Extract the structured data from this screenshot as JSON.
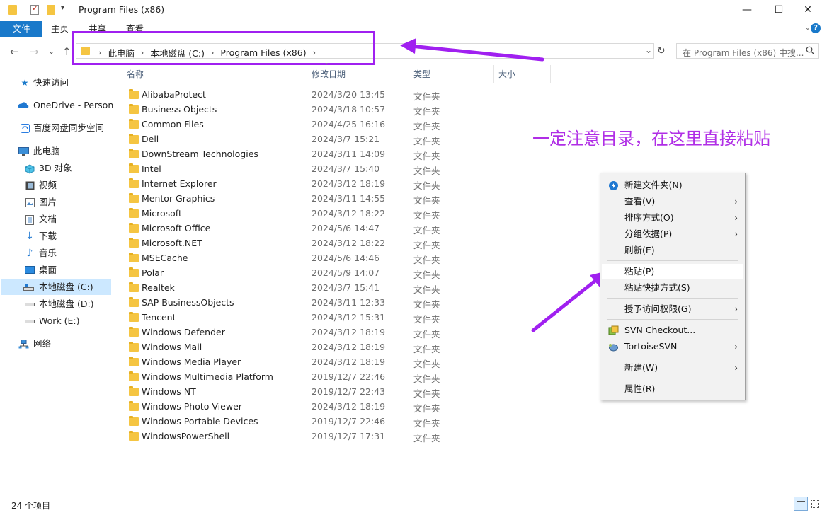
{
  "window": {
    "title": "Program Files (x86)",
    "controls": {
      "minimize": "—",
      "maximize": "☐",
      "close": "✕"
    }
  },
  "ribbon": {
    "tabs": [
      "文件",
      "主页",
      "共享",
      "查看"
    ],
    "file_tab_color": "#1979ca",
    "expand_glyph": "⌄",
    "help_glyph": "?"
  },
  "navigation": {
    "back_glyph": "←",
    "forward_glyph": "→",
    "recent_glyph": "⌄",
    "up_glyph": "↑",
    "breadcrumbs": [
      "此电脑",
      "本地磁盘 (C:)",
      "Program Files (x86)"
    ],
    "crumb_separator": "›",
    "dropdown_glyph": "⌄",
    "refresh_glyph": "↻",
    "search_placeholder": "在 Program Files (x86) 中搜...",
    "search_icon": "search-icon"
  },
  "sidebar": {
    "items": [
      {
        "label": "快速访问",
        "icon": "star-icon"
      },
      {
        "label": "OneDrive - Persona",
        "icon": "cloud-icon"
      },
      {
        "label": "百度网盘同步空间",
        "icon": "baidu-netdisk-icon"
      },
      {
        "label": "此电脑",
        "icon": "computer-icon"
      },
      {
        "label": "3D 对象",
        "icon": "3d-objects-icon"
      },
      {
        "label": "视频",
        "icon": "video-icon"
      },
      {
        "label": "图片",
        "icon": "pictures-icon"
      },
      {
        "label": "文档",
        "icon": "documents-icon"
      },
      {
        "label": "下载",
        "icon": "download-icon"
      },
      {
        "label": "音乐",
        "icon": "music-icon"
      },
      {
        "label": "桌面",
        "icon": "desktop-icon"
      },
      {
        "label": "本地磁盘 (C:)",
        "icon": "drive-c-icon",
        "selected": true
      },
      {
        "label": "本地磁盘 (D:)",
        "icon": "drive-icon"
      },
      {
        "label": "Work (E:)",
        "icon": "drive-icon"
      },
      {
        "label": "网络",
        "icon": "network-icon"
      }
    ]
  },
  "columns": {
    "name": "名称",
    "modified": "修改日期",
    "type": "类型",
    "size": "大小"
  },
  "files": [
    {
      "name": "AlibabaProtect",
      "modified": "2024/3/20 13:45",
      "type": "文件夹"
    },
    {
      "name": "Business Objects",
      "modified": "2024/3/18 10:57",
      "type": "文件夹"
    },
    {
      "name": "Common Files",
      "modified": "2024/4/25 16:16",
      "type": "文件夹"
    },
    {
      "name": "Dell",
      "modified": "2024/3/7 15:21",
      "type": "文件夹"
    },
    {
      "name": "DownStream Technologies",
      "modified": "2024/3/11 14:09",
      "type": "文件夹"
    },
    {
      "name": "Intel",
      "modified": "2024/3/7 15:40",
      "type": "文件夹"
    },
    {
      "name": "Internet Explorer",
      "modified": "2024/3/12 18:19",
      "type": "文件夹"
    },
    {
      "name": "Mentor Graphics",
      "modified": "2024/3/11 14:55",
      "type": "文件夹"
    },
    {
      "name": "Microsoft",
      "modified": "2024/3/12 18:22",
      "type": "文件夹"
    },
    {
      "name": "Microsoft Office",
      "modified": "2024/5/6 14:47",
      "type": "文件夹"
    },
    {
      "name": "Microsoft.NET",
      "modified": "2024/3/12 18:22",
      "type": "文件夹"
    },
    {
      "name": "MSECache",
      "modified": "2024/5/6 14:46",
      "type": "文件夹"
    },
    {
      "name": "Polar",
      "modified": "2024/5/9 14:07",
      "type": "文件夹"
    },
    {
      "name": "Realtek",
      "modified": "2024/3/7 15:41",
      "type": "文件夹"
    },
    {
      "name": "SAP BusinessObjects",
      "modified": "2024/3/11 12:33",
      "type": "文件夹"
    },
    {
      "name": "Tencent",
      "modified": "2024/3/12 15:31",
      "type": "文件夹"
    },
    {
      "name": "Windows Defender",
      "modified": "2024/3/12 18:19",
      "type": "文件夹"
    },
    {
      "name": "Windows Mail",
      "modified": "2024/3/12 18:19",
      "type": "文件夹"
    },
    {
      "name": "Windows Media Player",
      "modified": "2024/3/12 18:19",
      "type": "文件夹"
    },
    {
      "name": "Windows Multimedia Platform",
      "modified": "2019/12/7 22:46",
      "type": "文件夹"
    },
    {
      "name": "Windows NT",
      "modified": "2019/12/7 22:43",
      "type": "文件夹"
    },
    {
      "name": "Windows Photo Viewer",
      "modified": "2024/3/12 18:19",
      "type": "文件夹"
    },
    {
      "name": "Windows Portable Devices",
      "modified": "2019/12/7 22:46",
      "type": "文件夹"
    },
    {
      "name": "WindowsPowerShell",
      "modified": "2019/12/7 17:31",
      "type": "文件夹"
    }
  ],
  "annotation": {
    "text": "一定注意目录，在这里直接粘贴",
    "color": "#b02ee6"
  },
  "context_menu": {
    "items": [
      {
        "label": "新建文件夹(N)",
        "icon": "new-folder-icon"
      },
      {
        "label": "查看(V)",
        "submenu": true
      },
      {
        "label": "排序方式(O)",
        "submenu": true
      },
      {
        "label": "分组依据(P)",
        "submenu": true
      },
      {
        "label": "刷新(E)"
      },
      {
        "label": "粘贴(P)",
        "highlighted": true
      },
      {
        "label": "粘贴快捷方式(S)"
      },
      {
        "label": "授予访问权限(G)",
        "submenu": true
      },
      {
        "label": "SVN Checkout...",
        "icon": "svn-checkout-icon"
      },
      {
        "label": "TortoiseSVN",
        "icon": "tortoise-svn-icon",
        "submenu": true
      },
      {
        "label": "新建(W)",
        "submenu": true
      },
      {
        "label": "属性(R)"
      }
    ],
    "submenu_glyph": "›"
  },
  "status": {
    "item_count": "24 个项目"
  },
  "accent_color": "#a020f0"
}
